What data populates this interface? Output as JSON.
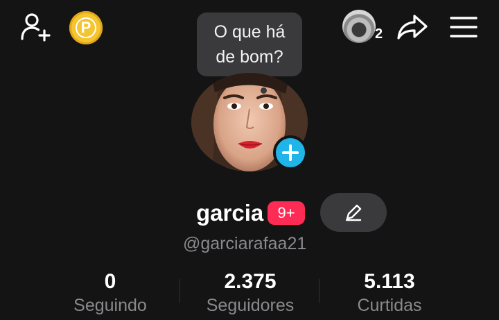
{
  "header": {
    "add_friend_icon": "person-add-icon",
    "coins_icon": "coin-p-icon",
    "coins_glyph": "P",
    "visitor_count": "2",
    "share_icon": "share-arrow-icon",
    "menu_icon": "hamburger-menu-icon"
  },
  "status_bubble": {
    "line1": "O que há",
    "line2": "de bom?"
  },
  "profile": {
    "display_name": "garcia",
    "notification_badge": "9+",
    "username": "@garciarafaa21",
    "add_photo_icon": "plus-icon",
    "edit_icon": "pencil-icon"
  },
  "stats": [
    {
      "value": "0",
      "label": "Seguindo"
    },
    {
      "value": "2.375",
      "label": "Seguidores"
    },
    {
      "value": "5.113",
      "label": "Curtidas"
    }
  ],
  "colors": {
    "background": "#141414",
    "accent_badge": "#fe2c55",
    "add_photo": "#20b4e8",
    "coin": "#f5c531",
    "secondary_text": "#8a8a8e",
    "pill_bg": "#3a3a3c"
  }
}
